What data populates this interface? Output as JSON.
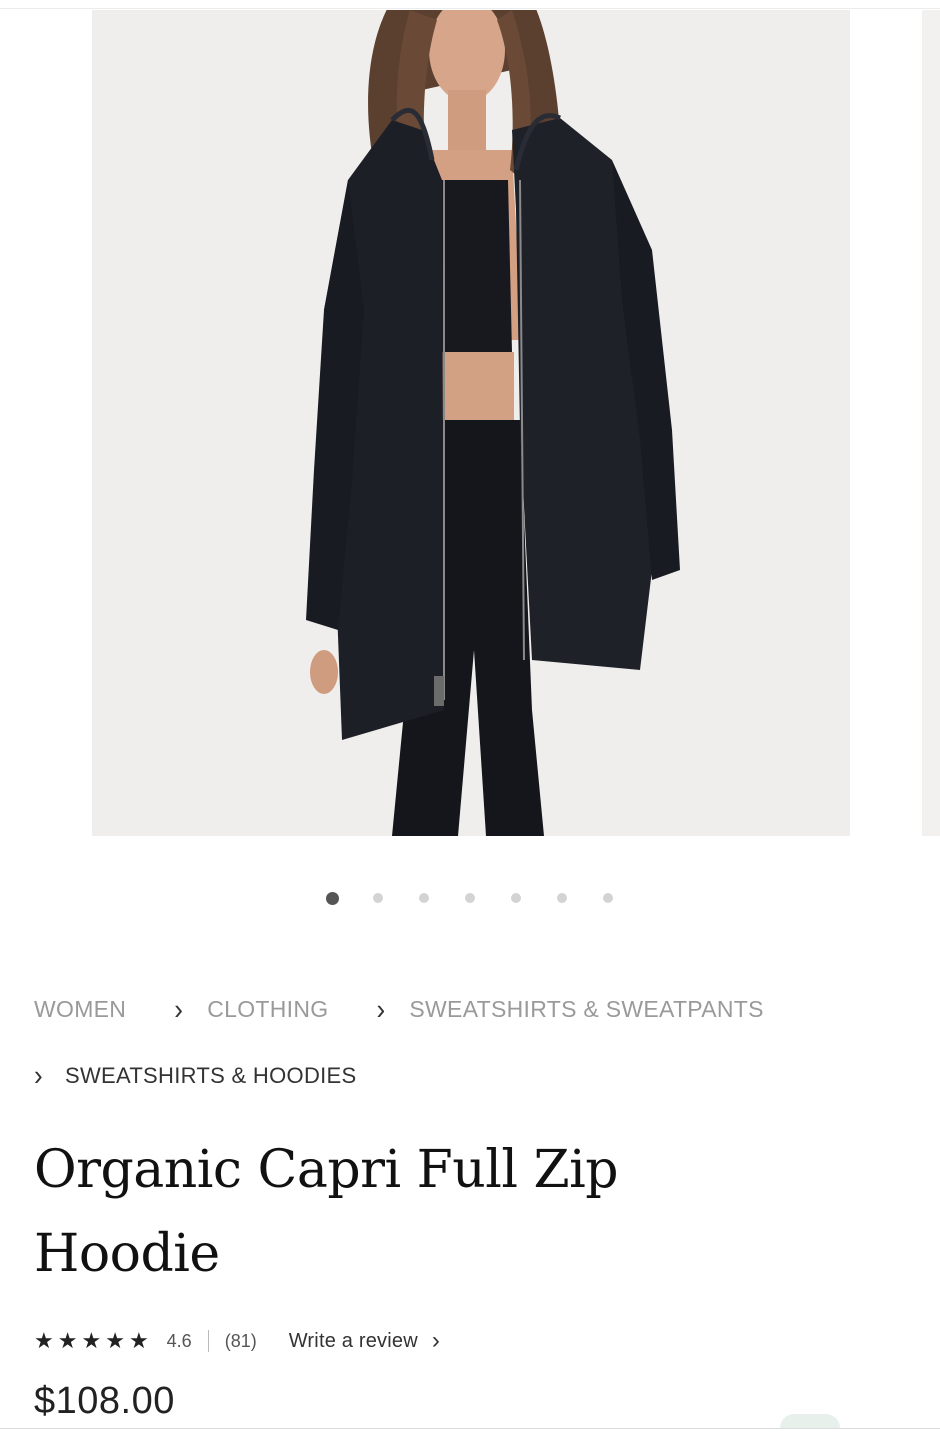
{
  "gallery": {
    "image_alt": "Model wearing black Organic Capri Full Zip Hoodie",
    "total_images": 7,
    "active_index": 0
  },
  "breadcrumb": {
    "items": [
      "WOMEN",
      "CLOTHING",
      "SWEATSHIRTS & SWEATPANTS",
      "SWEATSHIRTS & HOODIES"
    ],
    "separator_icon": "chevron-right-icon"
  },
  "product": {
    "title_line1": "Organic Capri Full Zip",
    "title_line2": "Hoodie",
    "rating": "4.6",
    "review_count": "(81)",
    "stars": 5,
    "write_review_label": "Write a review",
    "price": "$108.00"
  },
  "colors": {
    "gallery_bg": "#efeeec",
    "garment": "#1b1d24"
  }
}
